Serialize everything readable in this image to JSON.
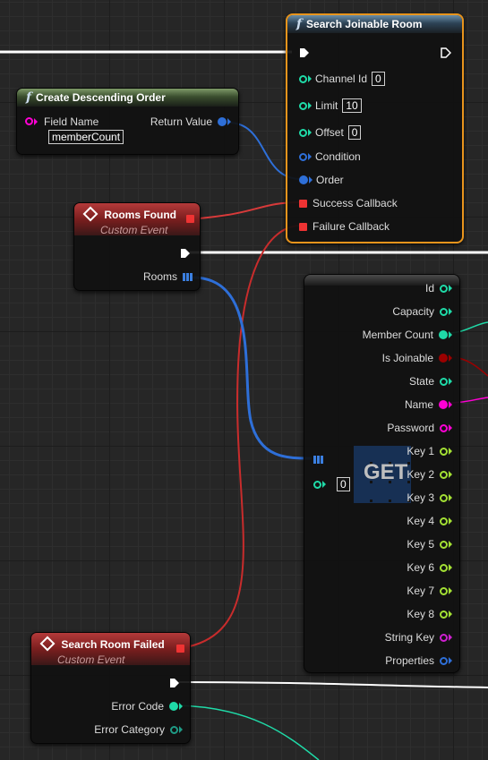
{
  "colors": {
    "exec": "#ffffff",
    "int": "#1fdba8",
    "object": "#2e6fd8",
    "string": "#ff00d4",
    "bool": "#9b0000",
    "delegate": "#ff3838",
    "structure": "#cf1fd0",
    "ints_array": "#2e6fd8",
    "key": "#a3e034",
    "selection_border": "#e8941c"
  },
  "search_node": {
    "title": "Search Joinable Room",
    "icon": "function-icon",
    "pins": [
      {
        "label": "Channel Id",
        "value": "0"
      },
      {
        "label": "Limit",
        "value": "10"
      },
      {
        "label": "Offset",
        "value": "0"
      },
      {
        "label": "Condition"
      },
      {
        "label": "Order"
      },
      {
        "label": "Success Callback"
      },
      {
        "label": "Failure Callback"
      }
    ]
  },
  "order_node": {
    "title": "Create Descending Order",
    "icon": "function-icon",
    "input_label": "Field Name",
    "input_value": "memberCount",
    "output_label": "Return Value"
  },
  "rooms_found_node": {
    "title": "Rooms Found",
    "subtitle": "Custom Event",
    "output_label": "Rooms"
  },
  "get_node": {
    "label": "GET",
    "index_value": "0",
    "outputs": [
      "Id",
      "Capacity",
      "Member Count",
      "Is Joinable",
      "State",
      "Name",
      "Password",
      "Key 1",
      "Key 2",
      "Key 3",
      "Key 4",
      "Key 5",
      "Key 6",
      "Key 7",
      "Key 8",
      "String Key",
      "Properties"
    ]
  },
  "failed_node": {
    "title": "Search Room Failed",
    "subtitle": "Custom Event",
    "outputs": [
      "Error Code",
      "Error Category"
    ]
  }
}
